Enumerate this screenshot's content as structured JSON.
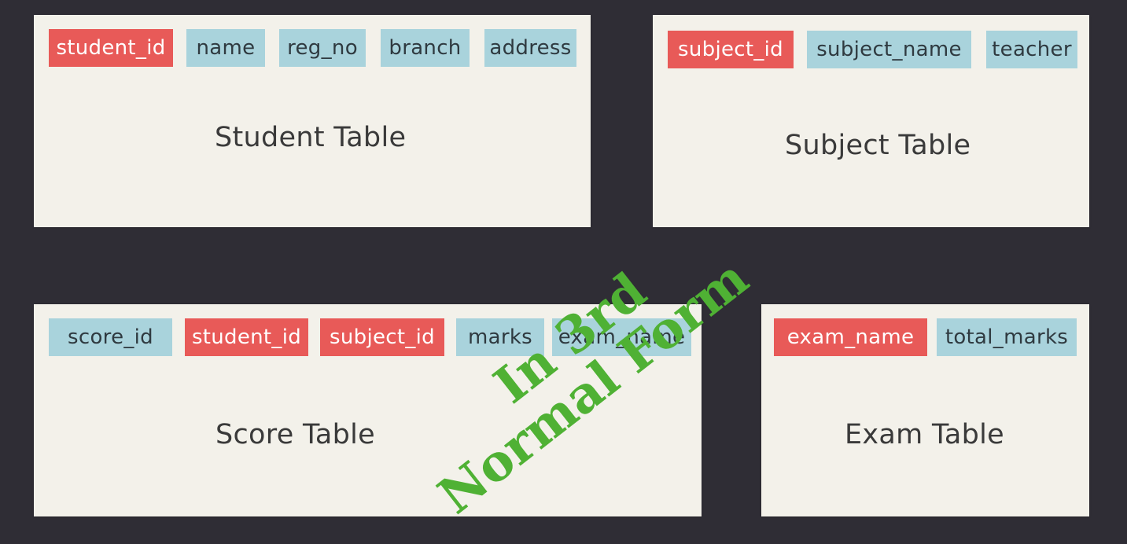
{
  "tables": {
    "student": {
      "title": "Student Table",
      "fields": [
        {
          "label": "student_id",
          "key": "primary"
        },
        {
          "label": "name",
          "key": "none"
        },
        {
          "label": "reg_no",
          "key": "none"
        },
        {
          "label": "branch",
          "key": "none"
        },
        {
          "label": "address",
          "key": "none"
        }
      ]
    },
    "subject": {
      "title": "Subject Table",
      "fields": [
        {
          "label": "subject_id",
          "key": "primary"
        },
        {
          "label": "subject_name",
          "key": "none"
        },
        {
          "label": "teacher",
          "key": "none"
        }
      ]
    },
    "score": {
      "title": "Score Table",
      "fields": [
        {
          "label": "score_id",
          "key": "none"
        },
        {
          "label": "student_id",
          "key": "primary"
        },
        {
          "label": "subject_id",
          "key": "primary"
        },
        {
          "label": "marks",
          "key": "none"
        },
        {
          "label": "exam_name",
          "key": "none"
        }
      ]
    },
    "exam": {
      "title": "Exam Table",
      "fields": [
        {
          "label": "exam_name",
          "key": "primary"
        },
        {
          "label": "total_marks",
          "key": "none"
        }
      ]
    }
  },
  "stamp": {
    "line1": "In 3rd",
    "line2": "Normal Form",
    "color": "#4fb134"
  },
  "colors": {
    "background": "#2f2d35",
    "card": "#f3f1ea",
    "key_field": "#e85a58",
    "attribute_field": "#a9d3dc"
  }
}
